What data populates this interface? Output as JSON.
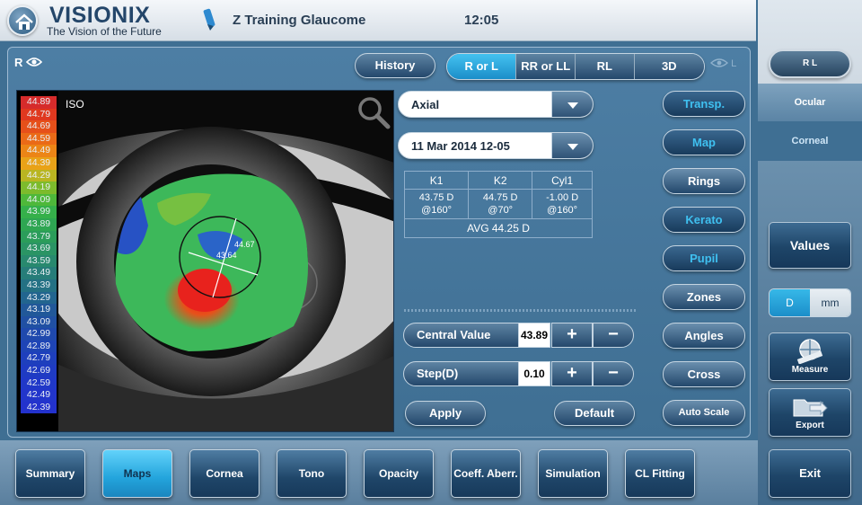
{
  "header": {
    "brand": "VISIONIX",
    "tagline": "The Vision of the Future",
    "patient": "Z Training Glaucome",
    "time": "12:05"
  },
  "view": {
    "eye_label": "R",
    "history_label": "History",
    "segments": [
      "R or L",
      "RR or LL",
      "RL",
      "3D"
    ],
    "active_segment": "R or L",
    "dim_eye_label": "L"
  },
  "map": {
    "iso_label": "ISO",
    "center_value_a": "43.64",
    "center_value_b": "44.67",
    "scale": [
      {
        "v": "44.89",
        "c": "#d62b2b"
      },
      {
        "v": "44.79",
        "c": "#e0381f"
      },
      {
        "v": "44.69",
        "c": "#e6501a"
      },
      {
        "v": "44.59",
        "c": "#ea6a17"
      },
      {
        "v": "44.49",
        "c": "#ec8516"
      },
      {
        "v": "44.39",
        "c": "#e9a218"
      },
      {
        "v": "44.29",
        "c": "#b9b521"
      },
      {
        "v": "44.19",
        "c": "#7dbb2c"
      },
      {
        "v": "44.09",
        "c": "#4eb83a"
      },
      {
        "v": "43.99",
        "c": "#35b04a"
      },
      {
        "v": "43.89",
        "c": "#2ea652"
      },
      {
        "v": "43.79",
        "c": "#2b9d5a"
      },
      {
        "v": "43.69",
        "c": "#2a9464"
      },
      {
        "v": "43.59",
        "c": "#28896e"
      },
      {
        "v": "43.49",
        "c": "#267d79"
      },
      {
        "v": "43.39",
        "c": "#247184"
      },
      {
        "v": "43.29",
        "c": "#22658f"
      },
      {
        "v": "43.19",
        "c": "#215899"
      },
      {
        "v": "43.09",
        "c": "#2050a3"
      },
      {
        "v": "42.99",
        "c": "#1f49ad"
      },
      {
        "v": "42.89",
        "c": "#1e44b6"
      },
      {
        "v": "42.79",
        "c": "#1e3fbd"
      },
      {
        "v": "42.69",
        "c": "#1f3bc3"
      },
      {
        "v": "42.59",
        "c": "#2038c8"
      },
      {
        "v": "42.49",
        "c": "#2235cb"
      },
      {
        "v": "42.39",
        "c": "#2332cd"
      }
    ]
  },
  "controls": {
    "map_type": "Axial",
    "exam_date": "11 Mar 2014 12-05",
    "k_table": {
      "headers": [
        "K1",
        "K2",
        "Cyl1"
      ],
      "row1": [
        "43.75 D",
        "44.75 D",
        "-1.00 D"
      ],
      "row2": [
        "@160°",
        "@70°",
        "@160°"
      ],
      "avg": "AVG 44.25 D"
    },
    "central_value_label": "Central Value",
    "central_value": "43.89",
    "step_label": "Step(D)",
    "step_value": "0.10",
    "plus": "+",
    "minus": "−",
    "apply_label": "Apply",
    "default_label": "Default"
  },
  "tools": [
    {
      "label": "Transp.",
      "active": true
    },
    {
      "label": "Map",
      "active": true
    },
    {
      "label": "Rings",
      "active": false
    },
    {
      "label": "Kerato",
      "active": true
    },
    {
      "label": "Pupil",
      "active": true
    },
    {
      "label": "Zones",
      "active": false
    },
    {
      "label": "Angles",
      "active": false
    },
    {
      "label": "Cross",
      "active": false
    },
    {
      "label": "Auto Scale",
      "active": false
    }
  ],
  "right_panel": {
    "eye_toggle": "R L",
    "ocular": "Ocular",
    "corneal": "Corneal",
    "values": "Values",
    "unit_d": "D",
    "unit_mm": "mm",
    "measure": "Measure",
    "export": "Export",
    "exit": "Exit"
  },
  "bottom_tabs": [
    "Summary",
    "Maps",
    "Cornea",
    "Tono",
    "Opacity",
    "Coeff. Aberr.",
    "Simulation",
    "CL Fitting"
  ],
  "active_tab": "Maps"
}
